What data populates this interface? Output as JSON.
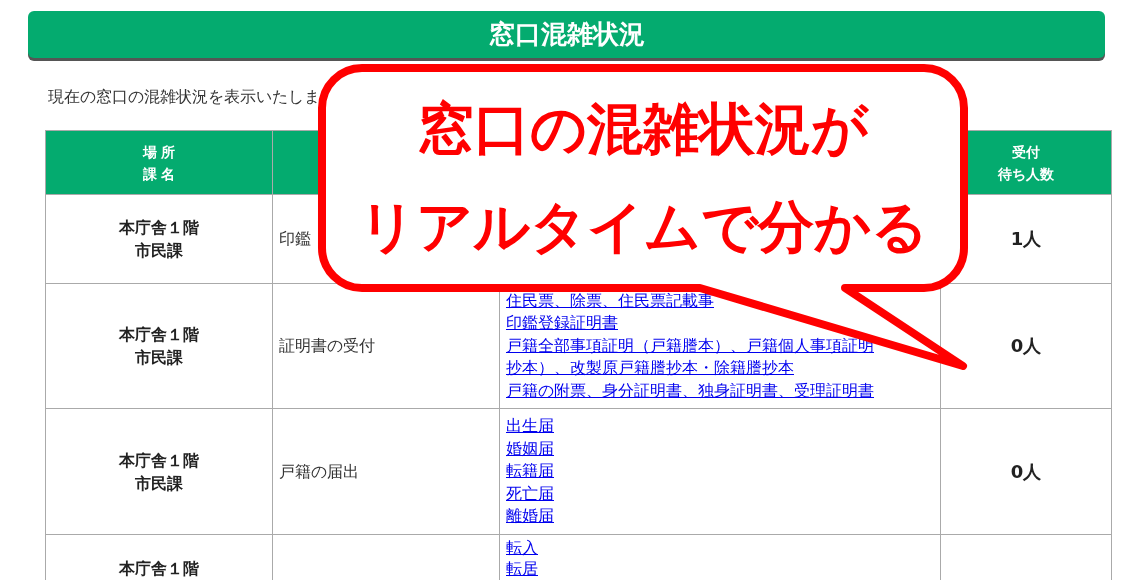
{
  "page_title": "窓口混雑状況",
  "description": "現在の窓口の混雑状況を表示いたしま",
  "table": {
    "header": {
      "column_1": [
        "場 所",
        "課 名"
      ],
      "column_4": [
        "受付",
        "待ち人数"
      ]
    },
    "rows": [
      {
        "place": [
          "本庁舎１階",
          "市民課"
        ],
        "service": "印鑑",
        "waiting": "1人"
      },
      {
        "place": [
          "本庁舎１階",
          "市民課"
        ],
        "service": "証明書の受付",
        "items": [
          "住民票、除票、住民票記載事",
          "印鑑登録証明書",
          "戸籍全部事項証明（戸籍謄本）、戸籍個人事項証明",
          "抄本）、改製原戸籍謄抄本・除籍謄抄本",
          "戸籍の附票、身分証明書、独身証明書、受理証明書"
        ],
        "waiting": "0人"
      },
      {
        "place": [
          "本庁舎１階",
          "市民課"
        ],
        "service": "戸籍の届出",
        "items": [
          "出生届",
          "婚姻届",
          "転籍届",
          "死亡届",
          "離婚届"
        ],
        "waiting": "0人"
      },
      {
        "place": [
          "本庁舎１階"
        ],
        "items": [
          "転入",
          "転居"
        ]
      }
    ]
  },
  "callout": {
    "lines": [
      "窓口の混雑状況が",
      "リアルタイムで分かる"
    ]
  }
}
